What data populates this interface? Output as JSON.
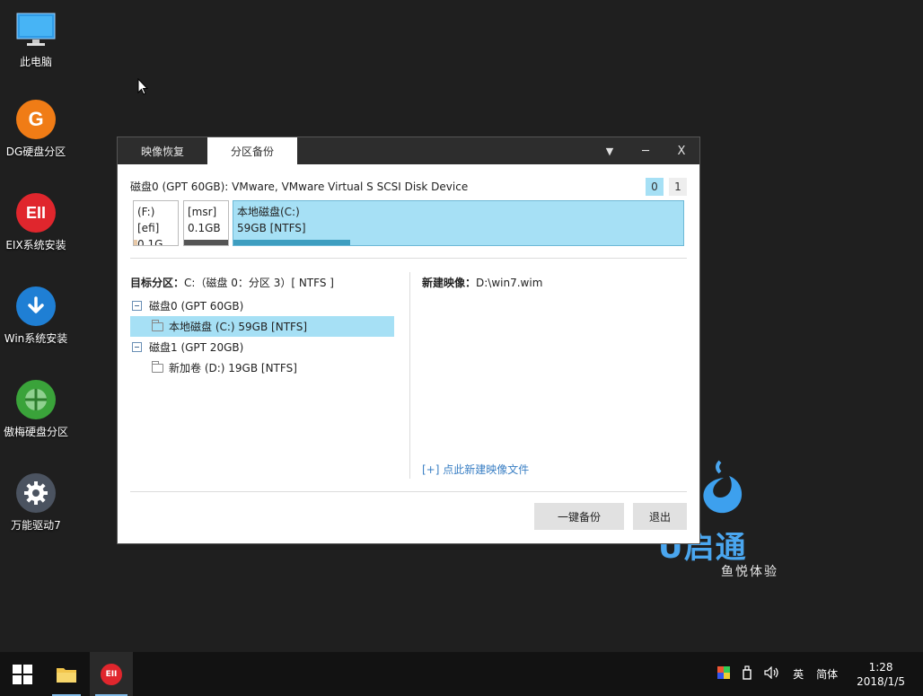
{
  "desktop": {
    "icons": [
      {
        "label": "此电脑",
        "icon": "computer-icon"
      },
      {
        "label": "DG硬盘分区",
        "icon": "dg-icon",
        "glyph": "G",
        "color": "#f07c16"
      },
      {
        "label": "EIX系统安装",
        "icon": "eix-icon",
        "glyph": "EII",
        "color": "#e0262d"
      },
      {
        "label": "Win系统安装",
        "icon": "download-icon",
        "color": "#1f7fd4"
      },
      {
        "label": "傲梅硬盘分区",
        "icon": "partition-pie-icon",
        "color": "#3aa33a"
      },
      {
        "label": "万能驱动7",
        "icon": "gear-icon",
        "color": "#4b5360"
      }
    ]
  },
  "window": {
    "tabs": [
      {
        "label": "映像恢复",
        "active": false
      },
      {
        "label": "分区备份",
        "active": true
      }
    ],
    "controls": {
      "menu": "▼",
      "minimize": "─",
      "close": "X"
    },
    "disk_header": "磁盘0 (GPT 60GB): VMware, VMware Virtual S SCSI Disk Device",
    "disk_pages": [
      "0",
      "1"
    ],
    "partitions": [
      {
        "name": "(F:)[efi]",
        "size": "0.1G...",
        "bar_color": "#e8c9a8",
        "fill": 0.08
      },
      {
        "name": "[msr]",
        "size": "0.1GB",
        "bar_color": "#555555",
        "fill": 1.0
      },
      {
        "name": "本地磁盘(C:)",
        "size": "59GB [NTFS]",
        "bar_color": "#3e9ec0",
        "fill": 0.26
      }
    ],
    "target": {
      "label": "目标分区：",
      "value": "C:（磁盘 0：分区 3）[ NTFS ]"
    },
    "tree": [
      {
        "label": "磁盘0 (GPT 60GB)",
        "type": "disk"
      },
      {
        "label": "本地磁盘 (C:) 59GB [NTFS]",
        "type": "partition",
        "selected": true
      },
      {
        "label": "磁盘1 (GPT 20GB)",
        "type": "disk"
      },
      {
        "label": "新加卷 (D:) 19GB [NTFS]",
        "type": "partition",
        "selected": false
      }
    ],
    "new_image": {
      "label": "新建映像：",
      "value": "D:\\win7.wim"
    },
    "new_image_link": "[+] 点此新建映像文件",
    "buttons": {
      "backup": "一键备份",
      "exit": "退出"
    }
  },
  "brand": {
    "name": "U启通",
    "tagline": "鱼悦体验"
  },
  "taskbar": {
    "tray": {
      "input_lang": "英",
      "input_mode": "简体",
      "time": "1:28",
      "date": "2018/1/5"
    }
  }
}
